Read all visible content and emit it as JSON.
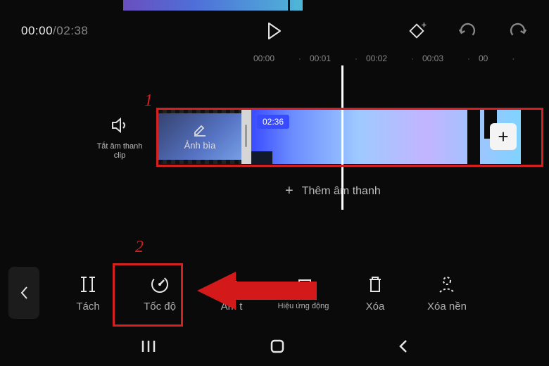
{
  "time": {
    "current": "00:00",
    "total": "02:38"
  },
  "ruler": [
    "00:00",
    "00:01",
    "00:02",
    "00:03",
    "00"
  ],
  "timeline": {
    "mute_label": "Tắt âm thanh clip",
    "cover_label": "Ảnh bìa",
    "clip_badge": "02:36",
    "add_audio": "Thêm âm thanh"
  },
  "annotations": {
    "one": "1",
    "two": "2"
  },
  "tools": {
    "split": "Tách",
    "speed": "Tốc độ",
    "audio": "Âm t",
    "effect": "Hiệu ứng động",
    "delete": "Xóa",
    "remove_bg": "Xóa nền"
  }
}
